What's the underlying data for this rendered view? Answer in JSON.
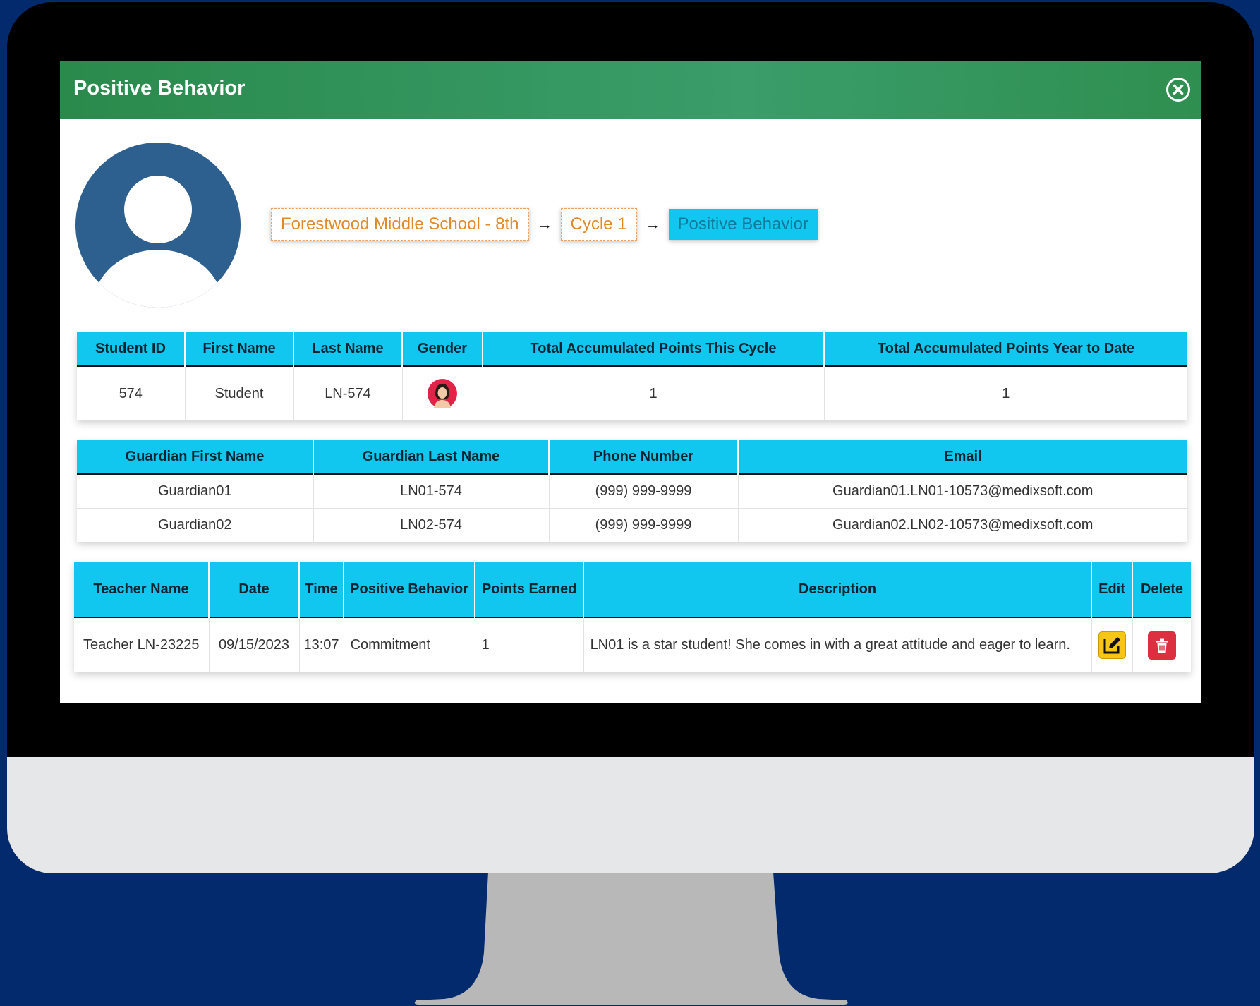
{
  "window": {
    "title": "Positive Behavior"
  },
  "breadcrumb": [
    "Forestwood Middle School - 8th",
    "Cycle 1",
    "Positive Behavior"
  ],
  "student_table": {
    "headers": [
      "Student ID",
      "First Name",
      "Last Name",
      "Gender",
      "Total Accumulated Points This Cycle",
      "Total Accumulated Points Year to Date"
    ],
    "row": {
      "id": "574",
      "first": "Student",
      "last": "LN-574",
      "cycle_points": "1",
      "ytd_points": "1"
    }
  },
  "guardian_table": {
    "headers": [
      "Guardian First Name",
      "Guardian Last Name",
      "Phone Number",
      "Email"
    ],
    "rows": [
      {
        "first": "Guardian01",
        "last": "LN01-574",
        "phone": "(999) 999-9999",
        "email": "Guardian01.LN01-10573@medixsoft.com"
      },
      {
        "first": "Guardian02",
        "last": "LN02-574",
        "phone": "(999) 999-9999",
        "email": "Guardian02.LN02-10573@medixsoft.com"
      }
    ]
  },
  "behavior_table": {
    "headers": [
      "Teacher Name",
      "Date",
      "Time",
      "Positive Behavior",
      "Points Earned",
      "Description",
      "Edit",
      "Delete"
    ],
    "row": {
      "teacher": "Teacher LN-23225",
      "date": "09/15/2023",
      "time": "13:07",
      "behavior": "Commitment",
      "points": "1",
      "description": "LN01 is a star student! She comes in with a great attitude and eager to learn."
    }
  },
  "colors": {
    "header_green": "#2a8a4c",
    "table_header": "#12c7ef",
    "background": "#022a6c",
    "edit": "#f5c518",
    "delete": "#dc2f3f"
  },
  "icons": [
    "close-icon",
    "avatar-icon",
    "female-icon",
    "edit-icon",
    "trash-icon"
  ]
}
